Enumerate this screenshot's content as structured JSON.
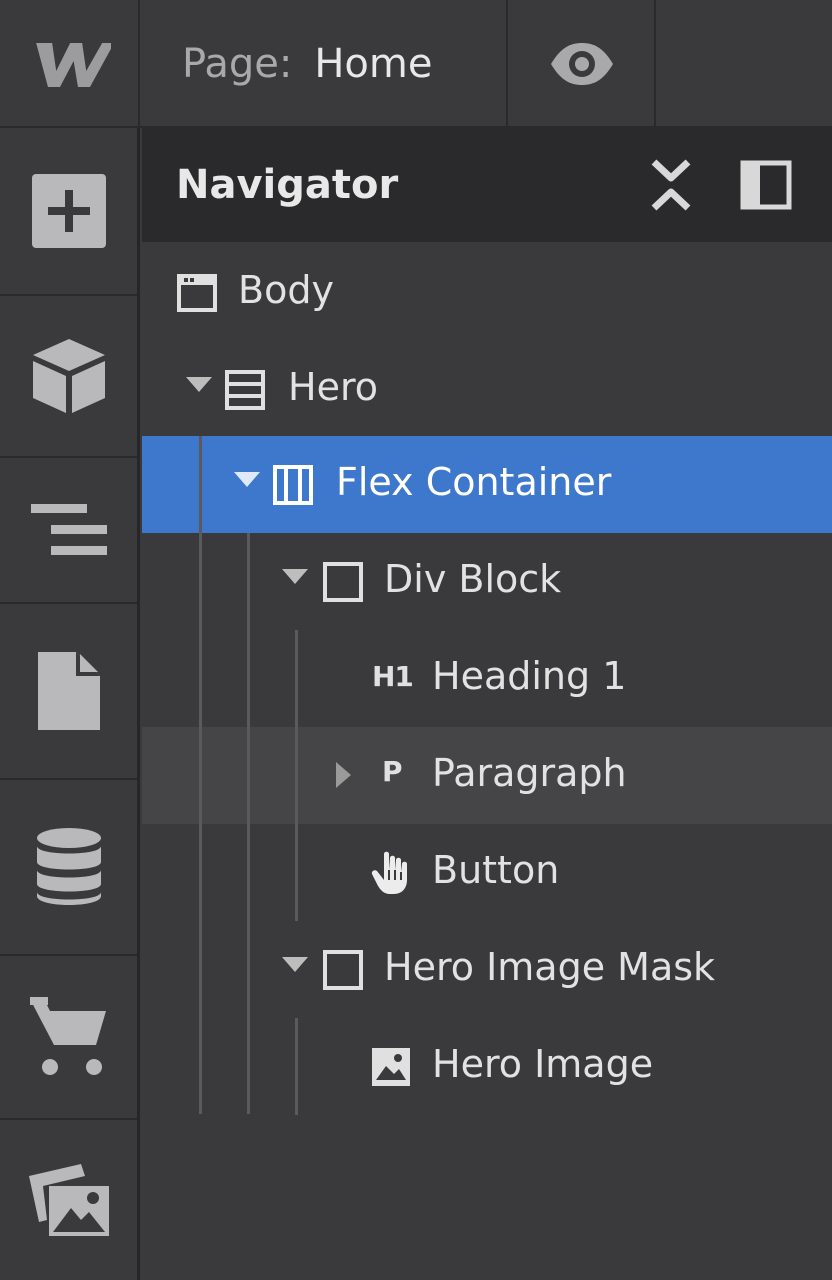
{
  "topbar": {
    "logo_icon": "webflow-logo-icon",
    "page_label": "Page:",
    "page_name": "Home",
    "preview_icon": "eye-icon"
  },
  "toolbar": {
    "items": [
      {
        "icon": "add-icon"
      },
      {
        "icon": "cube-icon"
      },
      {
        "icon": "navigator-icon"
      },
      {
        "icon": "page-icon"
      },
      {
        "icon": "database-icon"
      },
      {
        "icon": "cart-icon"
      },
      {
        "icon": "images-icon"
      }
    ]
  },
  "navigator": {
    "title": "Navigator",
    "collapse_icon": "collapse-icon",
    "dock_icon": "dock-panel-icon",
    "tree": [
      {
        "label": "Body",
        "icon": "body-icon",
        "depth": 0,
        "expanded": null
      },
      {
        "label": "Hero",
        "icon": "section-icon",
        "depth": 1,
        "expanded": true
      },
      {
        "label": "Flex Container",
        "icon": "container-icon",
        "depth": 2,
        "expanded": true,
        "selected": true
      },
      {
        "label": "Div Block",
        "icon": "div-block-icon",
        "depth": 3,
        "expanded": true
      },
      {
        "label": "Heading 1",
        "icon": "heading-icon",
        "icon_text": "H1",
        "depth": 4,
        "expanded": null
      },
      {
        "label": "Paragraph",
        "icon": "paragraph-icon",
        "icon_text": "P",
        "depth": 4,
        "expanded": false,
        "hovered": true
      },
      {
        "label": "Button",
        "icon": "hand-pointer-icon",
        "depth": 4,
        "expanded": null
      },
      {
        "label": "Hero Image Mask",
        "icon": "div-block-icon",
        "depth": 3,
        "expanded": true
      },
      {
        "label": "Hero Image",
        "icon": "image-icon",
        "depth": 4,
        "expanded": null
      }
    ]
  }
}
